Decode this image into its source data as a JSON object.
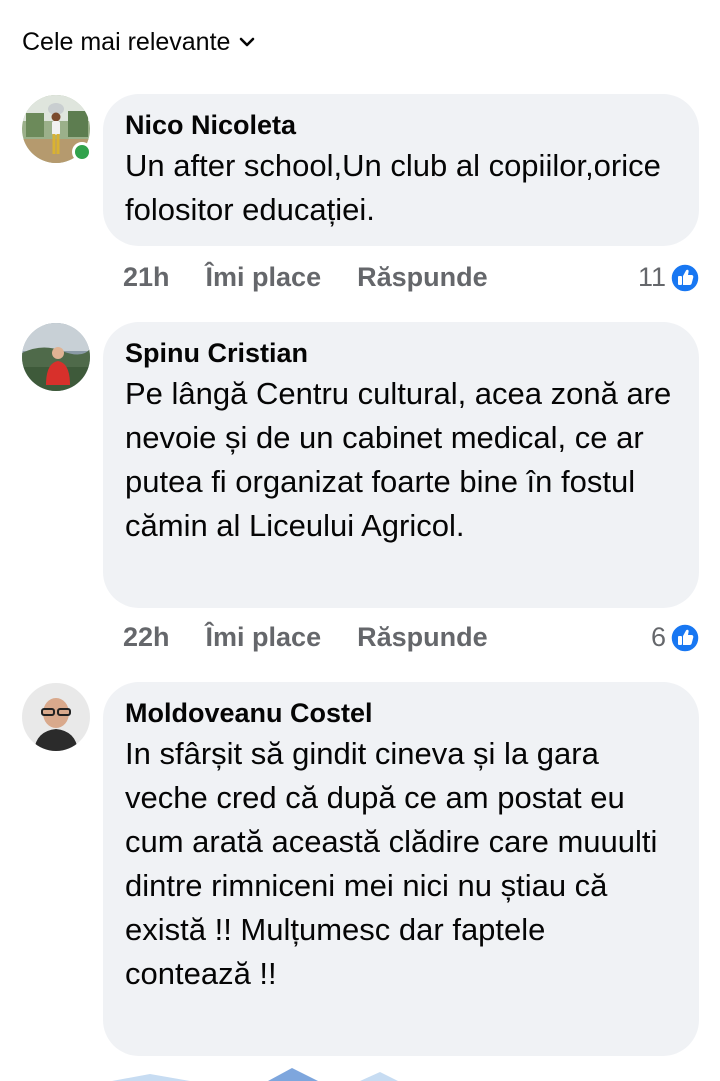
{
  "sort": {
    "label": "Cele mai relevante",
    "icon": "chevron-down-icon"
  },
  "comments": [
    {
      "author": "Nico Nicoleta",
      "text": "Un after school,Un club al copiilor,orice folositor educației.",
      "time": "21h",
      "like_label": "Îmi place",
      "reply_label": "Răspunde",
      "reaction_count": "11",
      "online": true
    },
    {
      "author": "Spinu Cristian",
      "text": "Pe lângă Centru cultural, acea zonă are nevoie și de un cabinet medical, ce ar putea fi organizat foarte bine în fostul cămin al Liceului Agricol.",
      "time": "22h",
      "like_label": "Îmi place",
      "reply_label": "Răspunde",
      "reaction_count": "6",
      "online": false
    },
    {
      "author": "Moldoveanu Costel",
      "text": "In sfârșit să gindit cineva și la gara veche cred că după ce am postat eu cum arată această clădire care muuulti dintre rimniceni mei nici nu știau că există !! Mulțumesc dar faptele contează !!",
      "online": false
    }
  ],
  "colors": {
    "bubble": "#f0f2f5",
    "meta_text": "#65676b",
    "like_blue": "#1877f2",
    "online_green": "#31a24c"
  }
}
